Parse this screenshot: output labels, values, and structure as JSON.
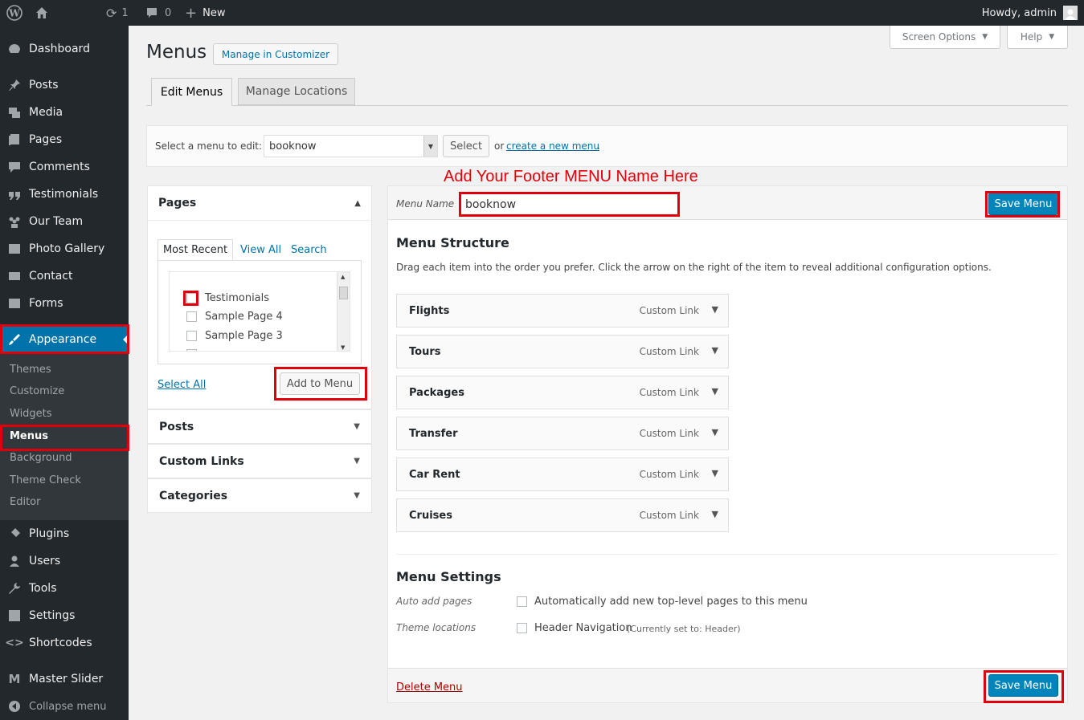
{
  "adminbar": {
    "updates_count": "1",
    "comments_count": "0",
    "new_label": "New",
    "howdy": "Howdy, admin"
  },
  "sidebar": {
    "top_items": [
      {
        "label": "Dashboard",
        "icon": "dashboard-icon"
      },
      {
        "label": "Posts",
        "icon": "pin-icon"
      },
      {
        "label": "Media",
        "icon": "media-icon"
      },
      {
        "label": "Pages",
        "icon": "pages-icon"
      },
      {
        "label": "Comments",
        "icon": "comment-icon"
      },
      {
        "label": "Testimonials",
        "icon": "quote-icon"
      },
      {
        "label": "Our Team",
        "icon": "team-icon"
      },
      {
        "label": "Photo Gallery",
        "icon": "image-icon"
      },
      {
        "label": "Contact",
        "icon": "mail-icon"
      },
      {
        "label": "Forms",
        "icon": "forms-icon"
      }
    ],
    "appearance": "Appearance",
    "appearance_sub": [
      "Themes",
      "Customize",
      "Widgets",
      "Menus",
      "Background",
      "Theme Check",
      "Editor"
    ],
    "bottom_items": [
      {
        "label": "Plugins",
        "icon": "plugin-icon"
      },
      {
        "label": "Users",
        "icon": "users-icon"
      },
      {
        "label": "Tools",
        "icon": "wrench-icon"
      },
      {
        "label": "Settings",
        "icon": "settings-icon"
      },
      {
        "label": "Shortcodes",
        "icon": "code-icon"
      }
    ],
    "master_slider": "Master Slider",
    "collapse": "Collapse menu"
  },
  "header": {
    "title": "Menus",
    "customizer_button": "Manage in Customizer",
    "screen_options": "Screen Options",
    "help": "Help"
  },
  "tabs": [
    "Edit Menus",
    "Manage Locations"
  ],
  "select_bar": {
    "label": "Select a menu to edit:",
    "selected": "booknow",
    "select_button": "Select",
    "or_text": "or",
    "create_link": "create a new menu",
    "period": "."
  },
  "annotation": "Add Your Footer MENU Name Here",
  "left_panel": {
    "pages_title": "Pages",
    "subtabs": [
      "Most Recent",
      "View All",
      "Search"
    ],
    "page_items": [
      "Testimonials",
      "Sample Page 4",
      "Sample Page 3"
    ],
    "select_all": "Select All",
    "add_to_menu": "Add to Menu",
    "sections": [
      "Posts",
      "Custom Links",
      "Categories"
    ]
  },
  "right_panel": {
    "menu_name_label": "Menu Name",
    "menu_name_value": "booknow",
    "save_menu": "Save Menu",
    "structure_title": "Menu Structure",
    "structure_desc": "Drag each item into the order you prefer. Click the arrow on the right of the item to reveal additional configuration options.",
    "items": [
      {
        "title": "Flights",
        "type": "Custom Link"
      },
      {
        "title": "Tours",
        "type": "Custom Link"
      },
      {
        "title": "Packages",
        "type": "Custom Link"
      },
      {
        "title": "Transfer",
        "type": "Custom Link"
      },
      {
        "title": "Car Rent",
        "type": "Custom Link"
      },
      {
        "title": "Cruises",
        "type": "Custom Link"
      }
    ],
    "settings_title": "Menu Settings",
    "auto_add_label": "Auto add pages",
    "auto_add_text": "Automatically add new top-level pages to this menu",
    "theme_locations_label": "Theme locations",
    "header_nav": "Header Navigation",
    "header_nav_note": "(Currently set to: Header)",
    "delete_menu": "Delete Menu"
  },
  "colors": {
    "accent": "#0085ba",
    "annotation_red": "#e0000b",
    "sidebar_bg": "#23282d"
  }
}
